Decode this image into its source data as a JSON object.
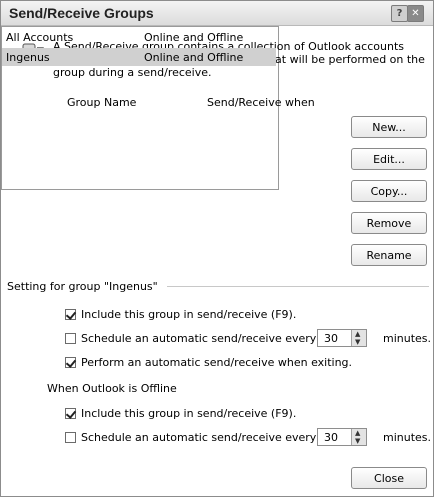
{
  "window": {
    "title": "Send/Receive Groups"
  },
  "titlebar": {
    "help_label": "?",
    "close_label": "✕"
  },
  "intro": {
    "text": "A Send/Receive group contains a collection of Outlook accounts and folders. You can specify the tasks that will be performed on the group during a send/receive."
  },
  "list": {
    "headers": {
      "name": "Group Name",
      "when": "Send/Receive when"
    },
    "rows": [
      {
        "name": "All Accounts",
        "when": "Online and Offline"
      },
      {
        "name": "Ingenus",
        "when": "Online and Offline"
      }
    ],
    "selected_index": 1
  },
  "buttons": {
    "new": "New...",
    "edit": "Edit...",
    "copy": "Copy...",
    "remove": "Remove",
    "rename": "Rename",
    "close": "Close"
  },
  "setting_section": {
    "label": "Setting for group \"Ingenus\"",
    "include": {
      "label": "Include this group in send/receive (F9).",
      "checked": true
    },
    "schedule": {
      "label": "Schedule an automatic send/receive every",
      "checked": false,
      "value": "30",
      "unit": "minutes."
    },
    "exiting": {
      "label": "Perform an automatic send/receive when exiting.",
      "checked": true
    }
  },
  "offline_section": {
    "label": "When Outlook is Offline",
    "include": {
      "label": "Include this group in send/receive (F9).",
      "checked": true
    },
    "schedule": {
      "label": "Schedule an automatic send/receive every",
      "checked": false,
      "value": "30",
      "unit": "minutes."
    }
  },
  "icons": {
    "groups": "send-receive-groups-icon",
    "spinner_up": "▲",
    "spinner_down": "▼"
  }
}
